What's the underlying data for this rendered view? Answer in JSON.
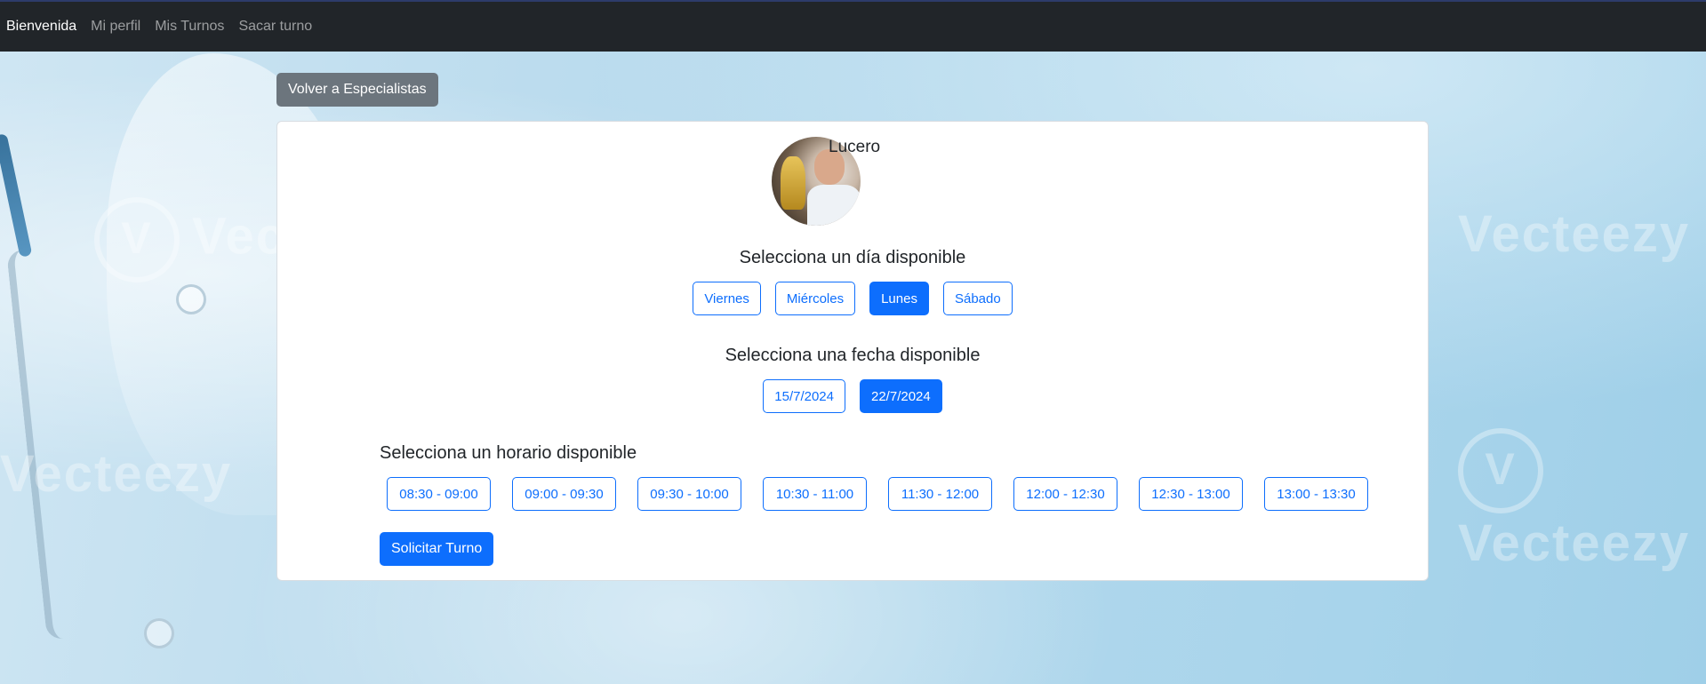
{
  "navbar": {
    "links": [
      {
        "label": "Bienvenida",
        "active": true
      },
      {
        "label": "Mi perfil",
        "active": false
      },
      {
        "label": "Mis Turnos",
        "active": false
      },
      {
        "label": "Sacar turno",
        "active": false
      }
    ]
  },
  "background": {
    "watermark_text": "Vecteezy"
  },
  "back_button": {
    "label": "Volver a Especialistas"
  },
  "specialist": {
    "name": "Lucero"
  },
  "days": {
    "title": "Selecciona un día disponible",
    "options": [
      "Viernes",
      "Miércoles",
      "Lunes",
      "Sábado"
    ],
    "selected": "Lunes"
  },
  "dates": {
    "title": "Selecciona una fecha disponible",
    "options": [
      "15/7/2024",
      "22/7/2024"
    ],
    "selected": "22/7/2024"
  },
  "hours": {
    "title": "Selecciona un horario disponible",
    "options": [
      "08:30 - 09:00",
      "09:00 - 09:30",
      "09:30 - 10:00",
      "10:30 - 11:00",
      "11:30 - 12:00",
      "12:00 - 12:30",
      "12:30 - 13:00",
      "13:00 - 13:30"
    ]
  },
  "submit_button": {
    "label": "Solicitar Turno"
  },
  "colors": {
    "navbar_bg": "#212529",
    "primary": "#0d6efd",
    "secondary": "#6c757d"
  }
}
